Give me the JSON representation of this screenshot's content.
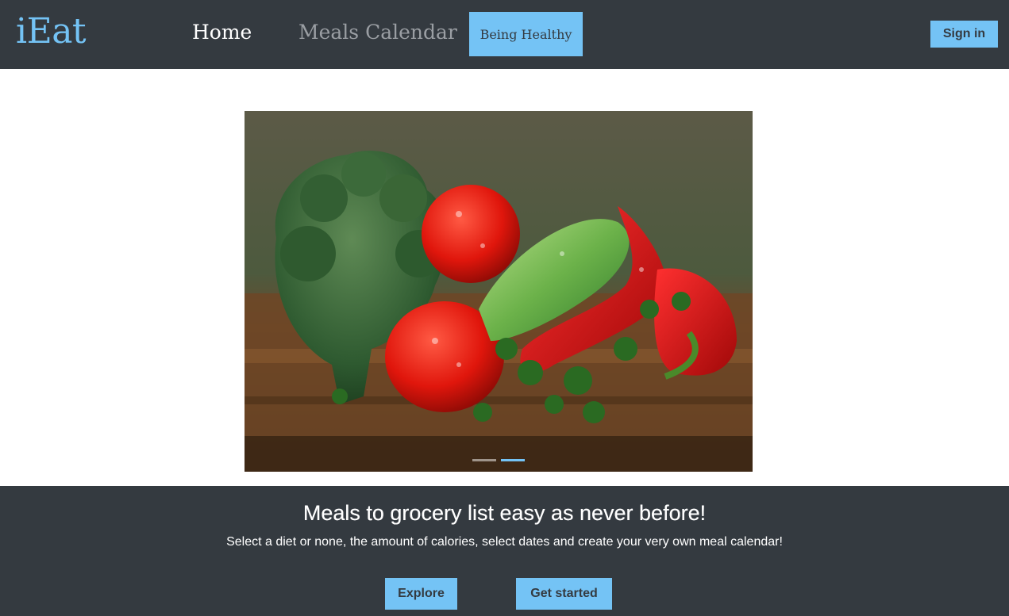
{
  "header": {
    "logo": "iEat",
    "nav": {
      "home": "Home",
      "meals_calendar": "Meals Calendar",
      "being_healthy": "Being Healthy"
    },
    "signin_label": "Sign in"
  },
  "carousel": {
    "slide_count": 2,
    "active_slide": 2,
    "image_description": "vegetables-photo"
  },
  "hero": {
    "title": "Meals to grocery list easy as never before!",
    "subtitle": "Select a diet or none, the amount of calories, select dates and create your very own meal calendar!",
    "explore_label": "Explore",
    "get_started_label": "Get started"
  },
  "colors": {
    "nav_bg": "#343a40",
    "accent": "#74c3f5",
    "inactive_nav": "#9a9ea3"
  }
}
